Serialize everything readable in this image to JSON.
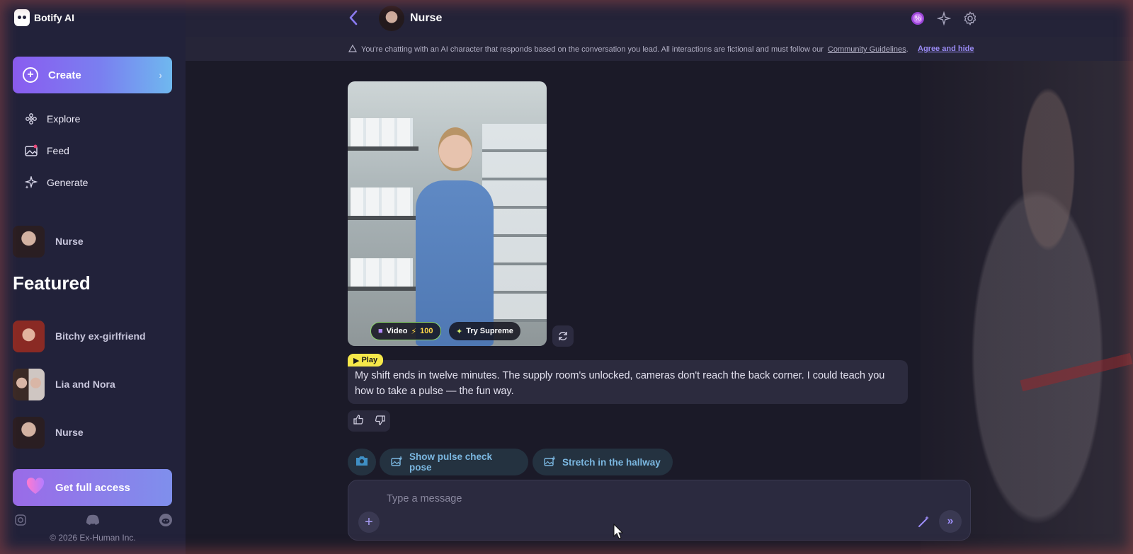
{
  "brand": {
    "name": "Botify AI"
  },
  "sidebar": {
    "create_label": "Create",
    "nav": [
      {
        "label": "Explore",
        "icon": "atom-icon"
      },
      {
        "label": "Feed",
        "icon": "image-feed-icon"
      },
      {
        "label": "Generate",
        "icon": "sparkles-icon"
      }
    ],
    "recent_character": "Nurse",
    "featured_title": "Featured",
    "featured": [
      {
        "name": "Bitchy ex-girlfriend"
      },
      {
        "name": "Lia and Nora"
      },
      {
        "name": "Nurse"
      }
    ],
    "access_label": "Get full access",
    "socials": [
      "instagram-icon",
      "discord-icon",
      "reddit-icon"
    ],
    "copyright": "© 2026 Ex-Human Inc."
  },
  "header": {
    "character_name": "Nurse",
    "icons": [
      "discount-badge-icon",
      "sparkles-icon",
      "gear-icon"
    ]
  },
  "notice": {
    "text": "You're chatting with an AI character that responds based on the conversation you lead. All interactions are fictional and must follow our",
    "link": "Community Guidelines",
    "period": ".",
    "agree": "Agree and hide"
  },
  "chat": {
    "image_actions": {
      "video_label": "Video",
      "video_cost": "100",
      "supreme_label": "Try Supreme"
    },
    "play_label": "Play",
    "message": "My shift ends in twelve minutes. The supply room's unlocked, cameras don't reach the back corner. I could teach you how to take a pulse — the fun way.",
    "suggestions": [
      {
        "label": "Show pulse check pose"
      },
      {
        "label": "Stretch in the hallway"
      }
    ]
  },
  "composer": {
    "placeholder": "Type a message"
  },
  "colors": {
    "accent": "#8b7cf2",
    "play_tag": "#f6e84a",
    "suggestion_text": "#7bb7e0"
  }
}
